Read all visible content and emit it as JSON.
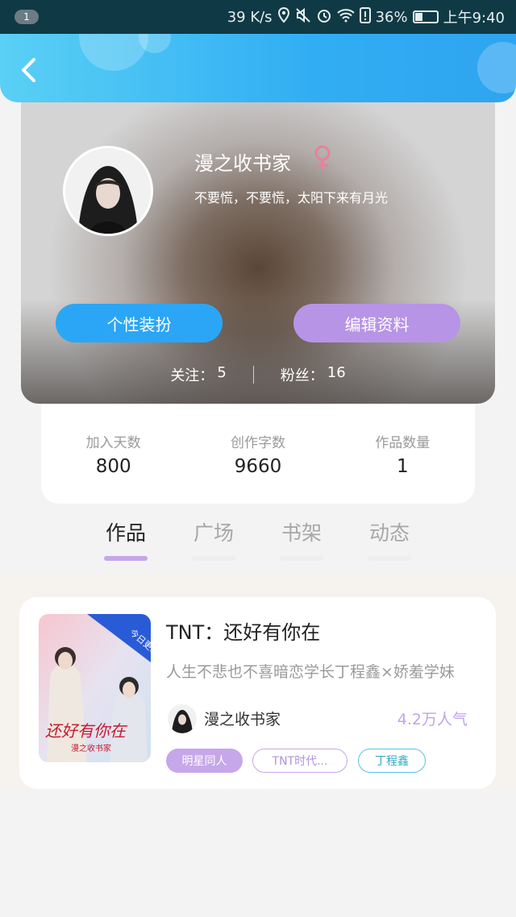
{
  "status_bar": {
    "notification_count": "1",
    "network_speed": "39 K/s",
    "battery_percent": "36%",
    "battery_level": 0.36,
    "time": "上午9:40",
    "icons": [
      "location-icon",
      "mute-icon",
      "alarm-icon",
      "wifi-icon",
      "alert-icon",
      "battery-icon"
    ]
  },
  "header": {
    "back_icon": "chevron-left-icon",
    "accent_colors": [
      "#5ad0f5",
      "#2fa4f0"
    ]
  },
  "profile": {
    "username": "漫之收书家",
    "gender_icon": "female-icon",
    "gender_color": "#e97f9c",
    "bio": "不要慌，不要慌，太阳下来有月光",
    "dress_button": "个性装扮",
    "edit_button": "编辑资料",
    "following_label": "关注：",
    "following_value": "5",
    "fans_label": "粉丝：",
    "fans_value": "16"
  },
  "stats": [
    {
      "label": "加入天数",
      "value": "800"
    },
    {
      "label": "创作字数",
      "value": "9660"
    },
    {
      "label": "作品数量",
      "value": "1"
    }
  ],
  "tabs": [
    {
      "label": "作品",
      "active": true
    },
    {
      "label": "广场",
      "active": false
    },
    {
      "label": "书架",
      "active": false
    },
    {
      "label": "动态",
      "active": false
    }
  ],
  "works": [
    {
      "title": "TNT：还好有你在",
      "description": "人生不悲也不喜暗恋学长丁程鑫×娇羞学妹",
      "author": "漫之收书家",
      "popularity": "4.2万人气",
      "tags": [
        "明星同人",
        "TNT时代...",
        "丁程鑫"
      ],
      "cover_badge": "今日更新",
      "cover_title": "还好有你在",
      "cover_author": "漫之收书家"
    }
  ]
}
